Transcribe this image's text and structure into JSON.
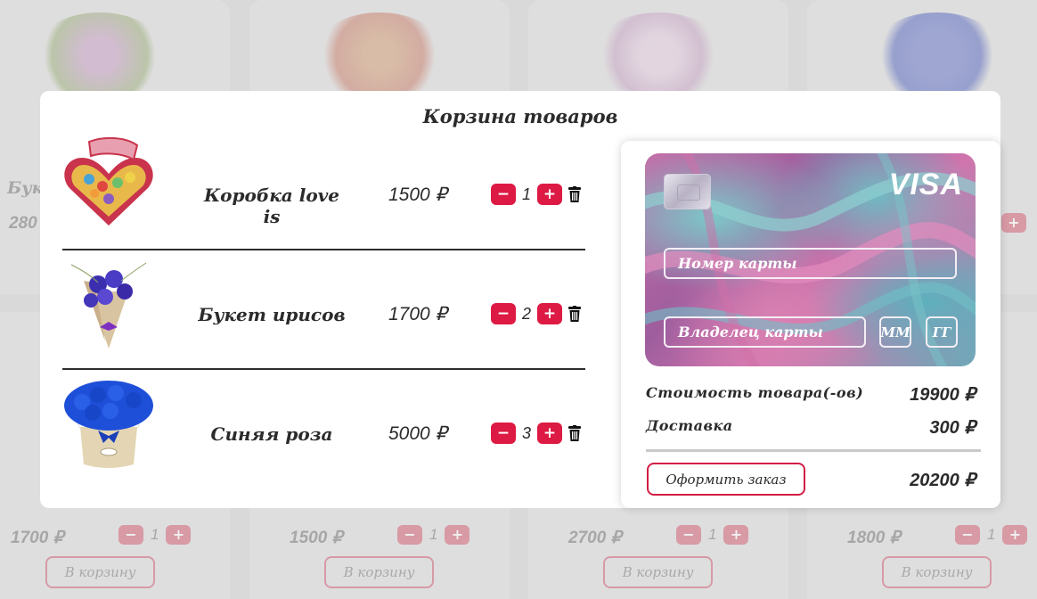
{
  "cart": {
    "title": "Корзина товаров",
    "items": [
      {
        "name": "Коробка love is",
        "price": "1500 ₽",
        "quantity": "1",
        "image": "candy-heart-box"
      },
      {
        "name": "Букет ирисов",
        "price": "1700 ₽",
        "quantity": "2",
        "image": "iris-bouquet"
      },
      {
        "name": "Синяя роза",
        "price": "5000 ₽",
        "quantity": "3",
        "image": "blue-rose-box"
      }
    ],
    "decrement_label": "−",
    "increment_label": "+",
    "delete_icon": "trash-icon"
  },
  "payment": {
    "card_brand": "VISA",
    "card_number_placeholder": "Номер карты",
    "card_holder_placeholder": "Владелец карты",
    "month_placeholder": "ММ",
    "year_placeholder": "ГГ",
    "goods_cost_label": "Стоимость товара(-ов)",
    "goods_cost_value": "19900 ₽",
    "delivery_label": "Доставка",
    "delivery_value": "300 ₽",
    "order_button": "Оформить заказ",
    "total_value": "20200 ₽"
  },
  "background": {
    "cards": [
      {
        "name": "Буке",
        "price": "280"
      },
      {
        "price": "1700 ₽",
        "quantity": "1",
        "cart_button": "В корзину"
      },
      {
        "price": "1500 ₽",
        "quantity": "1",
        "cart_button": "В корзину"
      },
      {
        "price": "2700 ₽",
        "quantity": "1",
        "cart_button": "В корзину"
      },
      {
        "price": "1800 ₽",
        "quantity": "1",
        "cart_button": "В корзину"
      }
    ],
    "decrement_label": "−",
    "increment_label": "+"
  },
  "colors": {
    "accent": "#dc1a43",
    "overlay": "#d9d9d9",
    "card_pink": "#c86aa6",
    "card_teal": "#7cc7c8"
  }
}
